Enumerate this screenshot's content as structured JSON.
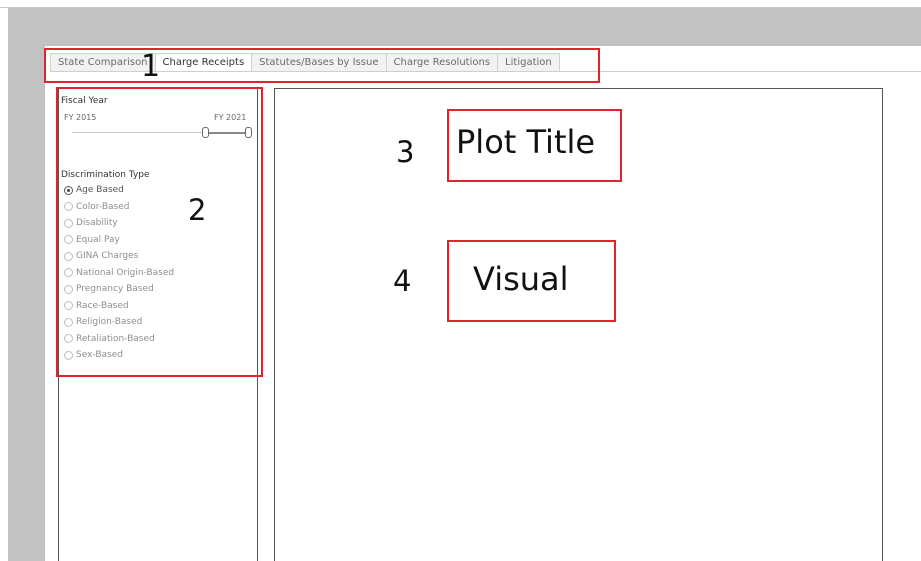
{
  "tabs": [
    {
      "label": "State Comparison",
      "active": false
    },
    {
      "label": "Charge Receipts",
      "active": true
    },
    {
      "label": "Statutes/Bases by Issue",
      "active": false
    },
    {
      "label": "Charge Resolutions",
      "active": false
    },
    {
      "label": "Litigation",
      "active": false
    }
  ],
  "filters": {
    "fiscal_year": {
      "title": "Fiscal Year",
      "min_label": "FY 2015",
      "max_label": "FY 2021"
    },
    "discrimination_type": {
      "title": "Discrimination Type",
      "options": [
        {
          "label": "Age Based",
          "selected": true
        },
        {
          "label": "Color-Based",
          "selected": false
        },
        {
          "label": "Disability",
          "selected": false
        },
        {
          "label": "Equal Pay",
          "selected": false
        },
        {
          "label": "GINA Charges",
          "selected": false
        },
        {
          "label": "National Origin-Based",
          "selected": false
        },
        {
          "label": "Pregnancy Based",
          "selected": false
        },
        {
          "label": "Race-Based",
          "selected": false
        },
        {
          "label": "Religion-Based",
          "selected": false
        },
        {
          "label": "Retaliation-Based",
          "selected": false
        },
        {
          "label": "Sex-Based",
          "selected": false
        }
      ]
    }
  },
  "annotations": {
    "n1": "1",
    "n2": "2",
    "n3": "3",
    "n4": "4",
    "plot_title": "Plot Title",
    "visual": "Visual",
    "color": "#e0242e"
  }
}
